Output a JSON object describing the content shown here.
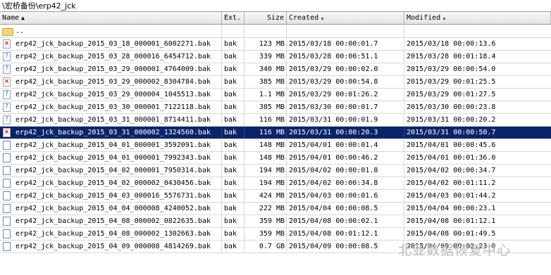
{
  "path": "\\宏桥备份\\erp42_jck",
  "columns": {
    "name": "Name",
    "ext": "Ext.",
    "size": "Size",
    "created": "Created",
    "modified": "Modified"
  },
  "rows": [
    {
      "icon": "folder",
      "name": "..",
      "ext": "",
      "size": "",
      "created": "",
      "modified": "",
      "selected": false
    },
    {
      "icon": "error",
      "name": "erp42_jck_backup_2015_03_18_000001_6002271.bak",
      "ext": "bak",
      "size": "123 MB",
      "created": "2015/03/18   00:00:01.7",
      "modified": "2015/03/18   00:00:13.6",
      "selected": false
    },
    {
      "icon": "unknown",
      "name": "erp42_jck_backup_2015_03_28_000016_6454712.bak",
      "ext": "bak",
      "size": "339 MB",
      "created": "2015/03/28   00:00:51.1",
      "modified": "2015/03/28   00:01:18.4",
      "selected": false
    },
    {
      "icon": "unknown",
      "name": "erp42_jck_backup_2015_03_29_000001_4764009.bak",
      "ext": "bak",
      "size": "340 MB",
      "created": "2015/03/29   00:00:02.0",
      "modified": "2015/03/29   00:00:54.0",
      "selected": false
    },
    {
      "icon": "error",
      "name": "erp42_jck_backup_2015_03_29_000002_8304784.bak",
      "ext": "bak",
      "size": "385 MB",
      "created": "2015/03/29   00:00:54.8",
      "modified": "2015/03/29   00:01:25.5",
      "selected": false
    },
    {
      "icon": "unknown",
      "name": "erp42_jck_backup_2015_03_29_000004_1045513.bak",
      "ext": "bak",
      "size": "1.1 MB",
      "created": "2015/03/29   00:01:26.2",
      "modified": "2015/03/29   00:01:27.5",
      "selected": false
    },
    {
      "icon": "unknown",
      "name": "erp42_jck_backup_2015_03_30_000001_7122118.bak",
      "ext": "bak",
      "size": "385 MB",
      "created": "2015/03/30   00:00:01.7",
      "modified": "2015/03/30   00:00:23.8",
      "selected": false
    },
    {
      "icon": "unknown",
      "name": "erp42_jck_backup_2015_03_31_000001_8714411.bak",
      "ext": "bak",
      "size": "116 MB",
      "created": "2015/03/31   00:00:01.9",
      "modified": "2015/03/31   00:00:20.2",
      "selected": false
    },
    {
      "icon": "error",
      "name": "erp42_jck_backup_2015_03_31_000002_1324560.bak",
      "ext": "bak",
      "size": "116 MB",
      "created": "2015/03/31   00:00:20.3",
      "modified": "2015/03/31   00:00:50.7",
      "selected": true
    },
    {
      "icon": "doc",
      "name": "erp42_jck_backup_2015_04_01_000001_3592091.bak",
      "ext": "bak",
      "size": "148 MB",
      "created": "2015/04/01   00:00:01.4",
      "modified": "2015/04/01   00:00:45.6",
      "selected": false
    },
    {
      "icon": "doc",
      "name": "erp42_jck_backup_2015_04_01_000001_7992343.bak",
      "ext": "bak",
      "size": "148 MB",
      "created": "2015/04/01   00:00:46.2",
      "modified": "2015/04/01   00:01:36.0",
      "selected": false
    },
    {
      "icon": "doc",
      "name": "erp42_jck_backup_2015_04_02_000001_7950314.bak",
      "ext": "bak",
      "size": "194 MB",
      "created": "2015/04/02   00:00:01.8",
      "modified": "2015/04/02   00:00:34.7",
      "selected": false
    },
    {
      "icon": "doc",
      "name": "erp42_jck_backup_2015_04_02_000002_0430456.bak",
      "ext": "bak",
      "size": "194 MB",
      "created": "2015/04/02   00:00:34.8",
      "modified": "2015/04/02   00:01:11.2",
      "selected": false
    },
    {
      "icon": "doc",
      "name": "erp42_jck_backup_2015_04_03_000016_5576731.bak",
      "ext": "bak",
      "size": "424 MB",
      "created": "2015/04/03   00:00:01.6",
      "modified": "2015/04/03   00:01:44.2",
      "selected": false
    },
    {
      "icon": "doc",
      "name": "erp42_jck_backup_2015_04_04_000008_4240052.bak",
      "ext": "bak",
      "size": "222 MB",
      "created": "2015/04/04   00:00:08.5",
      "modified": "2015/04/04   00:00:23.1",
      "selected": false
    },
    {
      "icon": "doc",
      "name": "erp42_jck_backup_2015_04_08_000002_0822635.bak",
      "ext": "bak",
      "size": "359 MB",
      "created": "2015/04/08   00:00:02.1",
      "modified": "2015/04/08   00:01:12.1",
      "selected": false
    },
    {
      "icon": "doc",
      "name": "erp42_jck_backup_2015_04_08_000002_1302663.bak",
      "ext": "bak",
      "size": "359 MB",
      "created": "2015/04/08   00:01:12.1",
      "modified": "2015/04/08   00:01:49.5",
      "selected": false
    },
    {
      "icon": "doc",
      "name": "erp42_jck_backup_2015_04_09_000008_4814269.bak",
      "ext": "bak",
      "size": "0.7 GB",
      "created": "2015/04/09   00:00:08.5",
      "modified": "2015/04/09   00:02:23.0",
      "selected": false
    }
  ],
  "watermark": "北亚数据恢复中心"
}
